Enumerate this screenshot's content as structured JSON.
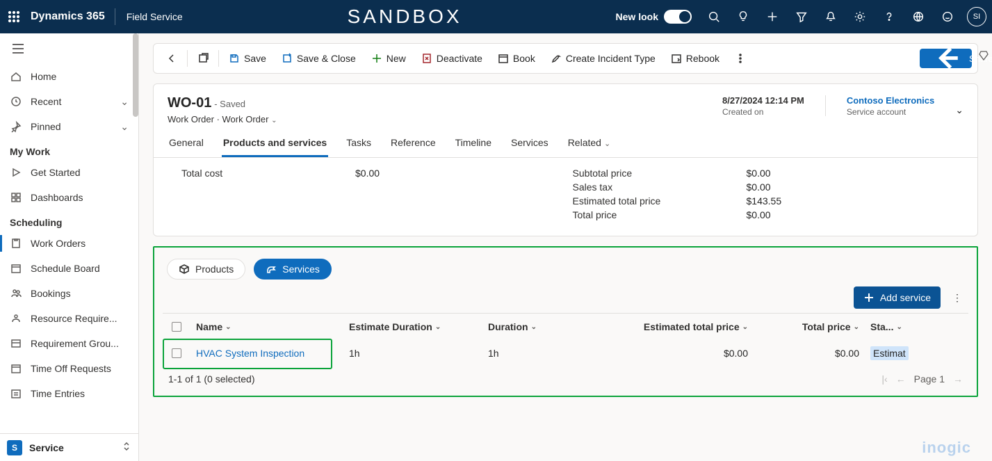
{
  "topbar": {
    "brand": "Dynamics 365",
    "app": "Field Service",
    "center": "SANDBOX",
    "newlook": "New look",
    "avatar": "SI"
  },
  "sidebar": {
    "items": [
      {
        "label": "Home"
      },
      {
        "label": "Recent"
      },
      {
        "label": "Pinned"
      }
    ],
    "group1": "My Work",
    "group1_items": [
      {
        "label": "Get Started"
      },
      {
        "label": "Dashboards"
      }
    ],
    "group2": "Scheduling",
    "group2_items": [
      {
        "label": "Work Orders"
      },
      {
        "label": "Schedule Board"
      },
      {
        "label": "Bookings"
      },
      {
        "label": "Resource Require..."
      },
      {
        "label": "Requirement Grou..."
      },
      {
        "label": "Time Off Requests"
      },
      {
        "label": "Time Entries"
      }
    ],
    "area": {
      "badge": "S",
      "label": "Service"
    }
  },
  "commands": {
    "back": "",
    "save": "Save",
    "saveclose": "Save & Close",
    "new": "New",
    "deactivate": "Deactivate",
    "book": "Book",
    "incident": "Create Incident Type",
    "rebook": "Rebook",
    "share": "Share"
  },
  "record": {
    "title": "WO-01",
    "saved": "- Saved",
    "entity": "Work Order",
    "form": "Work Order",
    "created_val": "8/27/2024 12:14 PM",
    "created_lbl": "Created on",
    "account_val": "Contoso Electronics",
    "account_lbl": "Service account",
    "tabs": [
      "General",
      "Products and services",
      "Tasks",
      "Reference",
      "Timeline",
      "Services",
      "Related"
    ],
    "active_tab": 1
  },
  "costs": {
    "left": [
      {
        "k": "Total cost",
        "v": "$0.00"
      }
    ],
    "right": [
      {
        "k": "Subtotal price",
        "v": "$0.00"
      },
      {
        "k": "Sales tax",
        "v": "$0.00"
      },
      {
        "k": "Estimated total price",
        "v": "$143.55"
      },
      {
        "k": "Total price",
        "v": "$0.00"
      }
    ]
  },
  "ps": {
    "tab_products": "Products",
    "tab_services": "Services",
    "add": "Add service",
    "columns": {
      "name": "Name",
      "est": "Estimate Duration",
      "dur": "Duration",
      "etp": "Estimated total price",
      "tp": "Total price",
      "sta": "Sta..."
    },
    "rows": [
      {
        "name": "HVAC System Inspection",
        "est": "1h",
        "dur": "1h",
        "etp": "$0.00",
        "tp": "$0.00",
        "sta": "Estimat"
      }
    ],
    "footer": "1-1 of 1 (0 selected)",
    "page": "Page 1"
  },
  "watermark": "inogic"
}
